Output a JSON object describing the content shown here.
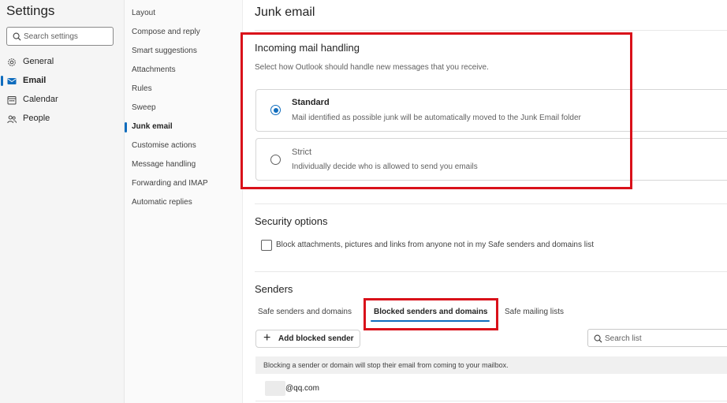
{
  "colors": {
    "accent": "#0f6cbd",
    "highlight": "#d9111a"
  },
  "settings": {
    "title": "Settings",
    "search_placeholder": "Search settings",
    "nav": [
      {
        "label": "General",
        "icon": "gear-icon"
      },
      {
        "label": "Email",
        "icon": "mail-icon",
        "selected": true
      },
      {
        "label": "Calendar",
        "icon": "calendar-icon"
      },
      {
        "label": "People",
        "icon": "people-icon"
      }
    ]
  },
  "categories": [
    "Layout",
    "Compose and reply",
    "Smart suggestions",
    "Attachments",
    "Rules",
    "Sweep",
    "Junk email",
    "Customise actions",
    "Message handling",
    "Forwarding and IMAP",
    "Automatic replies"
  ],
  "selected_category": "Junk email",
  "main": {
    "title": "Junk email",
    "incoming": {
      "heading": "Incoming mail handling",
      "description": "Select how Outlook should handle new messages that you receive.",
      "options": [
        {
          "title": "Standard",
          "description": "Mail identified as possible junk will be automatically moved to the Junk Email folder",
          "selected": true
        },
        {
          "title": "Strict",
          "description": "Individually decide who is allowed to send you emails",
          "selected": false
        }
      ]
    },
    "security": {
      "heading": "Security options",
      "checkbox_label": "Block attachments, pictures and links from anyone not in my Safe senders and domains list",
      "checked": false
    },
    "senders": {
      "heading": "Senders",
      "tabs": [
        "Safe senders and domains",
        "Blocked senders and domains",
        "Safe mailing lists"
      ],
      "active_tab": "Blocked senders and domains",
      "add_button": "Add blocked sender",
      "search_placeholder": "Search list",
      "info": "Blocking a sender or domain will stop their email from coming to your mailbox.",
      "entries": [
        "@qq.com"
      ]
    }
  }
}
